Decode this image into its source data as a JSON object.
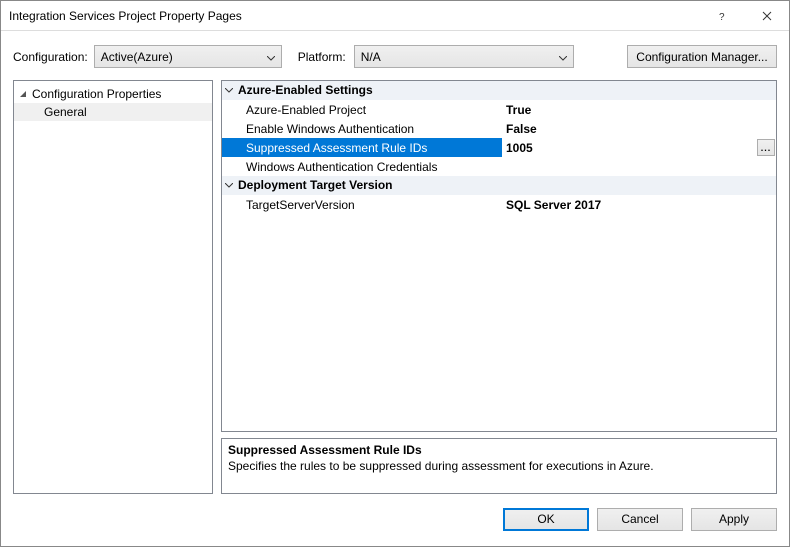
{
  "title": "Integration Services Project Property Pages",
  "configRow": {
    "configLabel": "Configuration:",
    "configValue": "Active(Azure)",
    "platformLabel": "Platform:",
    "platformValue": "N/A",
    "managerBtn": "Configuration Manager..."
  },
  "tree": {
    "parent": "Configuration Properties",
    "child": "General"
  },
  "grid": {
    "cat1": "Azure-Enabled Settings",
    "rows1": {
      "r0": {
        "name": "Azure-Enabled Project",
        "value": "True"
      },
      "r1": {
        "name": "Enable Windows Authentication",
        "value": "False"
      },
      "r2": {
        "name": "Suppressed Assessment Rule IDs",
        "value": "1005"
      },
      "r3": {
        "name": "Windows Authentication Credentials",
        "value": ""
      }
    },
    "cat2": "Deployment Target Version",
    "rows2": {
      "r0": {
        "name": "TargetServerVersion",
        "value": "SQL Server 2017"
      }
    }
  },
  "desc": {
    "title": "Suppressed Assessment Rule IDs",
    "text": "Specifies the rules to be suppressed during assessment for executions in Azure."
  },
  "footer": {
    "ok": "OK",
    "cancel": "Cancel",
    "apply": "Apply"
  },
  "ellipsis": "..."
}
